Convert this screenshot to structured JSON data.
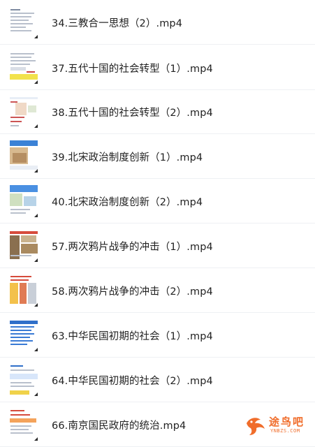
{
  "files": [
    {
      "title": "34.三教合一思想（2）.mp4",
      "thumb": "text"
    },
    {
      "title": "37.五代十国的社会转型（1）.mp4",
      "thumb": "yellow"
    },
    {
      "title": "38.五代十国的社会转型（2）.mp4",
      "thumb": "map"
    },
    {
      "title": "39.北宋政治制度创新（1）.mp4",
      "thumb": "blue-photo"
    },
    {
      "title": "40.北宋政治制度创新（2）.mp4",
      "thumb": "blue-map"
    },
    {
      "title": "57.两次鸦片战争的冲击（1）.mp4",
      "thumb": "photo"
    },
    {
      "title": "58.两次鸦片战争的冲击（2）.mp4",
      "thumb": "red-text"
    },
    {
      "title": "63.中华民国初期的社会（1）.mp4",
      "thumb": "blue-list"
    },
    {
      "title": "64.中华民国初期的社会（2）.mp4",
      "thumb": "blue-list2"
    },
    {
      "title": "66.南京国民政府的统治.mp4",
      "thumb": "red-text2"
    }
  ],
  "watermark": {
    "text": "途鸟吧",
    "sub": "YNBZS.COM"
  },
  "colors": {
    "title": "#222222",
    "divider": "#eef0f3",
    "accent": "#f06d2b"
  }
}
